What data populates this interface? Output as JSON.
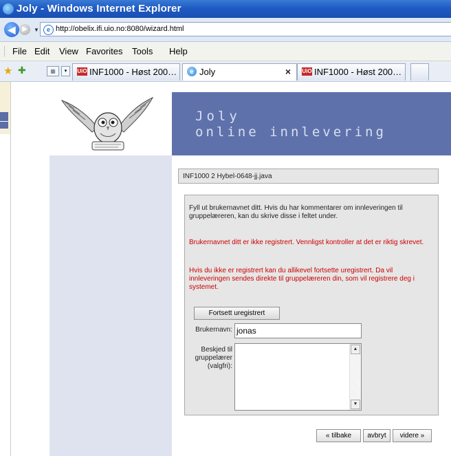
{
  "window": {
    "title": "Joly - Windows Internet Explorer"
  },
  "address_bar": {
    "url": "http://obelix.ifi.uio.no:8080/wizard.html"
  },
  "menu": [
    "File",
    "Edit",
    "View",
    "Favorites",
    "Tools",
    "Help"
  ],
  "tabs": [
    {
      "label": "INF1000 - Høst 200…",
      "favicon": "uio-icon",
      "active": false
    },
    {
      "label": "Joly",
      "favicon": "ie-icon",
      "active": true,
      "close": "×"
    },
    {
      "label": "INF1000 - Høst 200…",
      "favicon": "uio-icon",
      "active": false
    }
  ],
  "header": {
    "title": "Joly",
    "subtitle": "online innlevering"
  },
  "file_label": "INF1000 2 Hybel-0648-jj.java",
  "instructions": "Fyll ut brukernavnet ditt. Hvis du har kommentarer om innleveringen til gruppelæreren, kan du skrive disse i feltet under.",
  "error_not_registered": "Brukernavnet ditt er ikke registrert. Vennligst kontroller at det er riktig skrevet.",
  "unregistered_info": "Hvis du ikke er registrert kan du allikevel fortsette uregistrert. Da vil innleveringen sendes direkte til gruppelæreren din, som vil registrere deg i systemet.",
  "continue_unregistered_button": "Fortsett uregistrert",
  "form": {
    "username_label": "Brukernavn:",
    "username_value": "jonas",
    "message_label_lines": [
      "Beskjed til",
      "gruppelærer",
      "(valgfri):"
    ],
    "message_value": ""
  },
  "buttons": {
    "back": "« tilbake",
    "cancel": "avbryt",
    "next": "videre »"
  },
  "colors": {
    "header_band": "#5e71ab",
    "sidebar": "#dfe3ef",
    "error_text": "#cc0000"
  }
}
